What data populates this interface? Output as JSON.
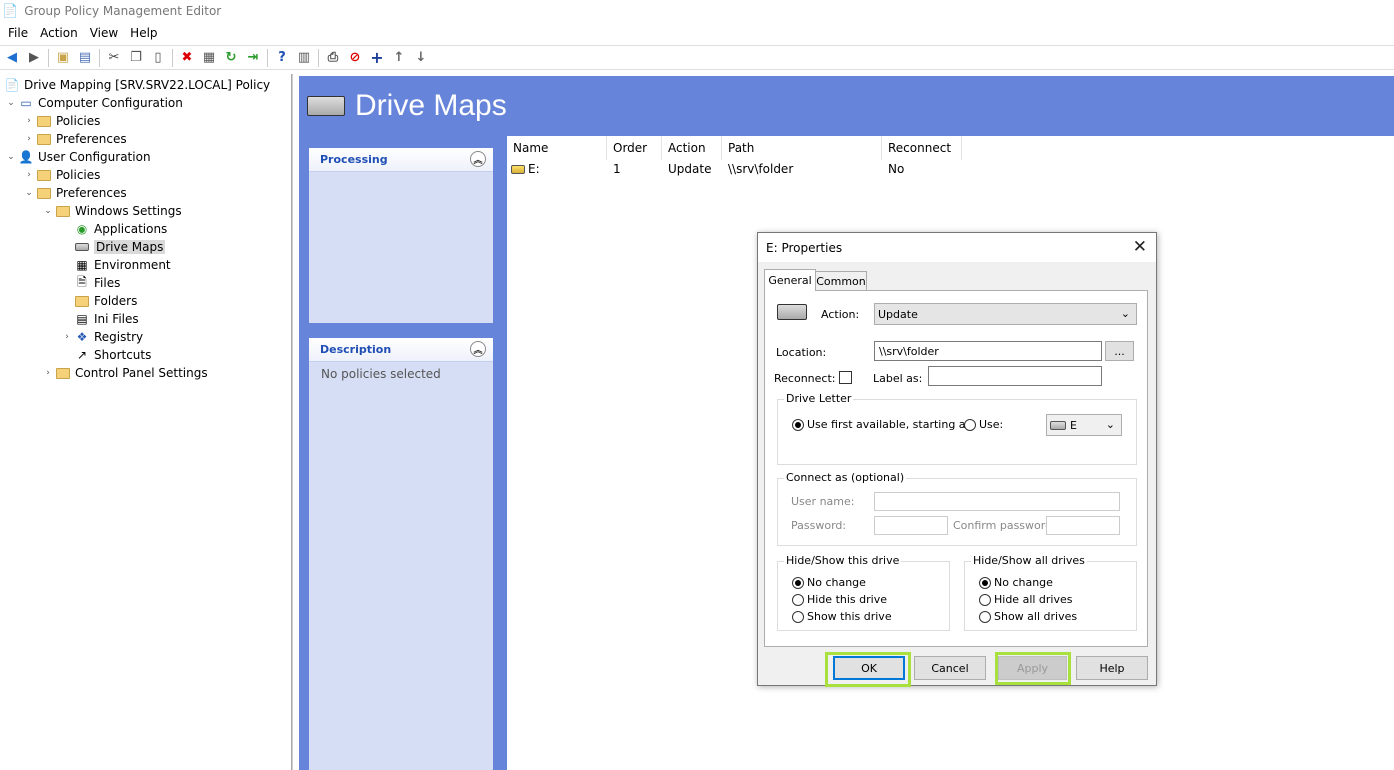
{
  "window": {
    "title": "Group Policy Management Editor"
  },
  "menu": [
    "File",
    "Action",
    "View",
    "Help"
  ],
  "tree": {
    "root": "Drive Mapping [SRV.SRV22.LOCAL] Policy",
    "computer_config": "Computer Configuration",
    "cc_policies": "Policies",
    "cc_preferences": "Preferences",
    "user_config": "User Configuration",
    "uc_policies": "Policies",
    "uc_preferences": "Preferences",
    "windows_settings": "Windows Settings",
    "applications": "Applications",
    "drive_maps": "Drive Maps",
    "environment": "Environment",
    "files": "Files",
    "folders": "Folders",
    "ini_files": "Ini Files",
    "registry": "Registry",
    "shortcuts": "Shortcuts",
    "control_panel": "Control Panel Settings"
  },
  "banner": {
    "title": "Drive Maps"
  },
  "panels": {
    "processing": {
      "title": "Processing"
    },
    "description": {
      "title": "Description",
      "text": "No policies selected"
    }
  },
  "list": {
    "columns": [
      "Name",
      "Order",
      "Action",
      "Path",
      "Reconnect"
    ],
    "rows": [
      {
        "name": "E:",
        "order": "1",
        "action": "Update",
        "path": "\\\\srv\\folder",
        "reconnect": "No"
      }
    ]
  },
  "dialog": {
    "title": "E: Properties",
    "tabs": [
      "General",
      "Common"
    ],
    "action_label": "Action:",
    "action_value": "Update",
    "location_label": "Location:",
    "location_value": "\\\\srv\\folder",
    "browse": "...",
    "reconnect_label": "Reconnect:",
    "reconnect_checked": false,
    "label_as": "Label as:",
    "label_as_value": "",
    "drive_letter_group": "Drive Letter",
    "use_first": "Use first available, starting at:",
    "use": "Use:",
    "drive_value": "E",
    "connect_as_group": "Connect as (optional)",
    "user_name": "User name:",
    "password": "Password:",
    "confirm_password": "Confirm password:",
    "hide_this_group": "Hide/Show this drive",
    "hide_this_options": [
      "No change",
      "Hide this drive",
      "Show this drive"
    ],
    "hide_all_group": "Hide/Show all drives",
    "hide_all_options": [
      "No change",
      "Hide all drives",
      "Show all drives"
    ],
    "buttons": {
      "ok": "OK",
      "cancel": "Cancel",
      "apply": "Apply",
      "help": "Help"
    },
    "highlight_color": "#a8e03e"
  },
  "colors": {
    "banner": "#6684d9",
    "panel_header_text": "#1f4fb4"
  }
}
